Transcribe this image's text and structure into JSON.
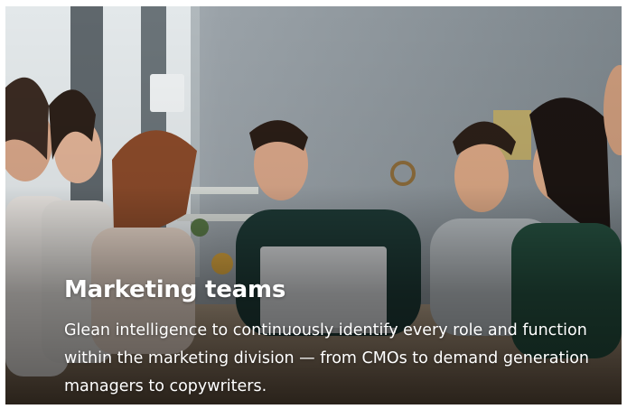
{
  "card": {
    "title": "Marketing teams",
    "description": "Glean intelligence to continuously identify every role and function within the marketing division — from CMOs to demand generation managers to copywriters."
  },
  "colors": {
    "text": "#ffffff",
    "wall": "#8e969c"
  }
}
